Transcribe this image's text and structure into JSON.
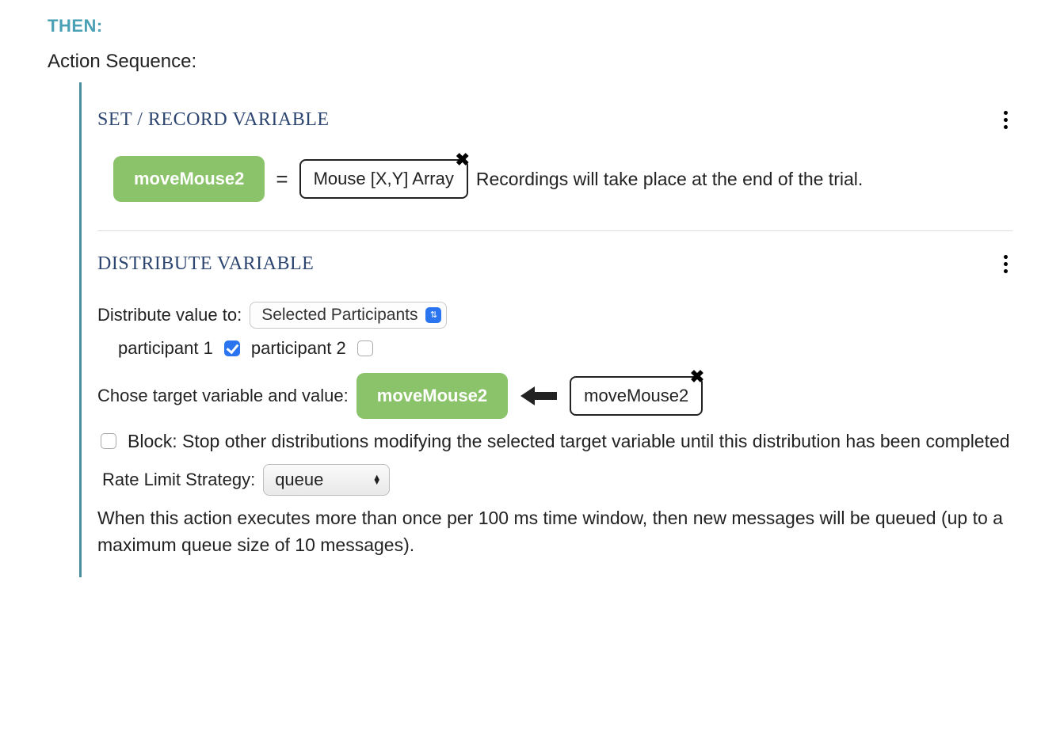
{
  "header": {
    "then_label": "THEN:",
    "action_sequence_label": "Action Sequence:"
  },
  "actions": {
    "set": {
      "title": "SET / RECORD VARIABLE",
      "variable_name": "moveMouse2",
      "equals": "=",
      "value_box": "Mouse [X,Y] Array",
      "description": "Recordings will take place at the end of the trial."
    },
    "distribute": {
      "title": "DISTRIBUTE VARIABLE",
      "distribute_label": "Distribute value to:",
      "distribute_select": "Selected Participants",
      "participant1_label": "participant 1",
      "participant1_checked": true,
      "participant2_label": "participant 2",
      "participant2_checked": false,
      "chose_label": "Chose target variable and value:",
      "target_variable": "moveMouse2",
      "source_value_box": "moveMouse2",
      "block_checked": false,
      "block_label": "Block: Stop other distributions modifying the selected target variable until this distribution has been completed",
      "rate_label": "Rate Limit Strategy:",
      "rate_select": "queue",
      "rate_description": "When this action executes more than once per 100 ms time window, then new messages will be queued (up to a maximum queue size of 10 messages)."
    }
  }
}
